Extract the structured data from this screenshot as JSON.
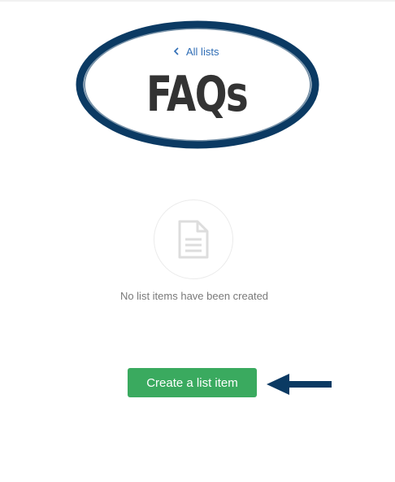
{
  "header": {
    "back_link_label": "All lists",
    "title": "FAQs"
  },
  "empty_state": {
    "icon": "document-icon",
    "message": "No list items have been created"
  },
  "actions": {
    "create_button_label": "Create a list item"
  },
  "colors": {
    "link": "#2f6db5",
    "title": "#333333",
    "button": "#3aaa5f",
    "annotation": "#0b3a63"
  }
}
